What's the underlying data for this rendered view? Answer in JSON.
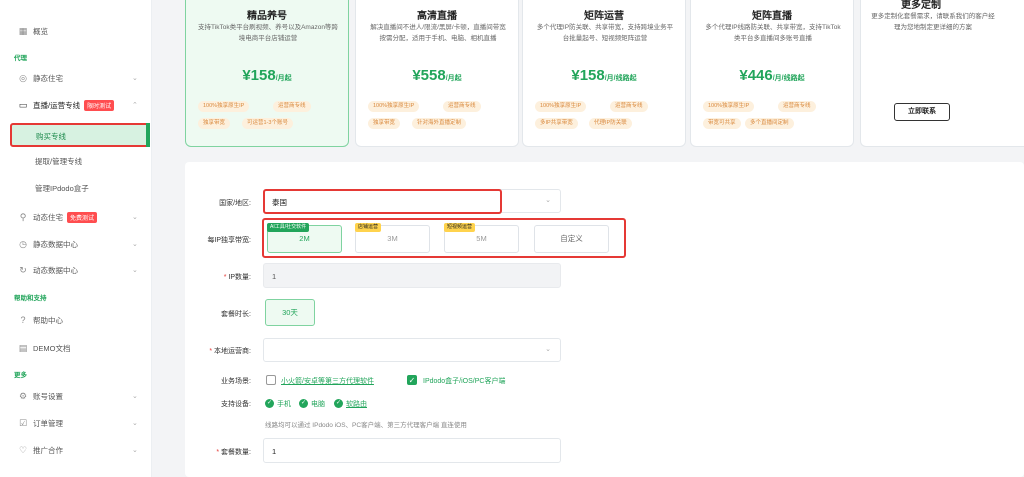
{
  "sidebar": {
    "overview": "概览",
    "group_proxy": "代理",
    "static_residential": "静态住宅",
    "live_line": "直播/运营专线",
    "live_line_badge": "限时测试",
    "buy_line": "购买专线",
    "manage_line": "提取/管理专线",
    "manage_box": "管理IPdodo盒子",
    "dynamic_residential": "动态住宅",
    "dynamic_badge": "免费测试",
    "static_dc": "静态数据中心",
    "dynamic_dc": "动态数据中心",
    "group_help": "帮助和支持",
    "help_center": "帮助中心",
    "demo_docs": "DEMO文档",
    "group_more": "更多",
    "account_settings": "账号设置",
    "order_mgmt": "订单管理",
    "partner": "推广合作"
  },
  "plans": [
    {
      "title": "精品养号",
      "desc": "支持TikTok类平台刷视频、养号以及Amazon等跨境电商平台店铺运营",
      "price": "¥158",
      "unit": "/月起",
      "tags": [
        "100%独享原生IP",
        "运营商专线",
        "独享带宽",
        "可运营1-3个账号"
      ]
    },
    {
      "title": "高清直播",
      "desc": "解决直播间不进人/限流/黑屏/卡顿，直播间带宽按需分配，适用于手机、电脑、相机直播",
      "price": "¥558",
      "unit": "/月起",
      "tags": [
        "100%独享原生IP",
        "运营商专线",
        "独享带宽",
        "针对海外直播定制"
      ]
    },
    {
      "title": "矩阵运营",
      "desc": "多个代理IP防关联、共享带宽，支持跨境业务平台批量起号、短视频矩阵运营",
      "price": "¥158",
      "unit": "/月/线路起",
      "tags": [
        "100%独享原生IP",
        "运营商专线",
        "多IP共享带宽",
        "代理IP防关联"
      ]
    },
    {
      "title": "矩阵直播",
      "desc": "多个代理IP线路防关联、共享带宽，支持TikTok类平台多直播间多账号直播",
      "price": "¥446",
      "unit": "/月/线路起",
      "tags": [
        "100%独享原生IP",
        "运营商专线",
        "带宽可共享",
        "多个直播间定制"
      ]
    },
    {
      "title": "更多定制",
      "desc": "更多定制化套餐需求，请联系我们的客户经理为您地制定更详细的方案",
      "button": "立即联系"
    }
  ],
  "form": {
    "country_label": "国家/地区:",
    "country_value": "泰国",
    "bandwidth_label": "每IP独享带宽:",
    "bandwidth_options": [
      {
        "tag": "AI工具/社交软件",
        "label": "2M"
      },
      {
        "tag": "店铺运营",
        "label": "3M"
      },
      {
        "tag": "短视频运营",
        "label": "5M"
      },
      {
        "tag": "",
        "label": "自定义"
      }
    ],
    "ip_count_label": "IP数量:",
    "ip_count_value": "1",
    "duration_label": "套餐时长:",
    "duration_value": "30天",
    "isp_label": "本地运营商:",
    "isp_value": "",
    "scenario_label": "业务场景:",
    "scenario_opt1": "小火箭/安卓等第三方代理软件",
    "scenario_opt2": "IPdodo盒子/iOS/PC客户端",
    "devices_label": "支持设备:",
    "device_phone": "手机",
    "device_pc": "电脑",
    "device_router": "软路由",
    "note": "线路均可以通过 IPdodo iOS、PC客户端、第三方代理客户端 直连使用",
    "package_count_label": "套餐数量:",
    "package_count_value": "1"
  },
  "colors": {
    "accent": "#22a55b",
    "highlight": "#e53935",
    "tag_bg": "#fdf0dd"
  }
}
